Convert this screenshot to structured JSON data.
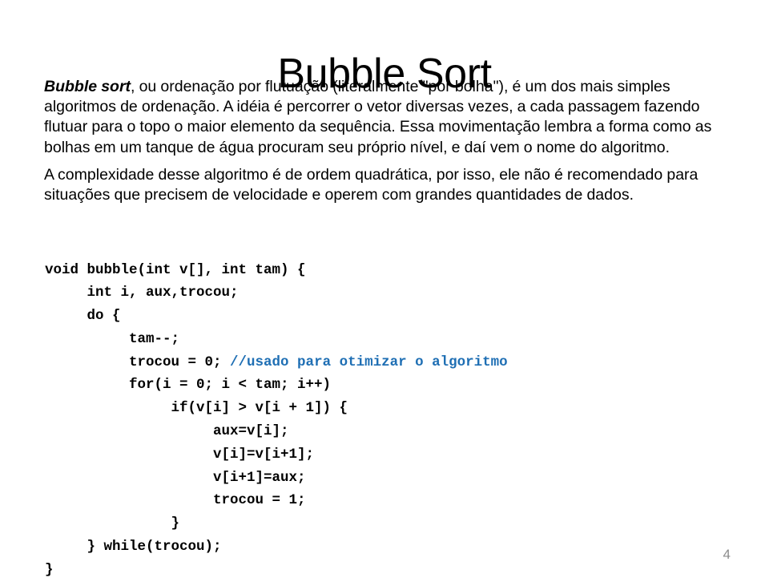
{
  "slide": {
    "title": "Bubble Sort",
    "page_number": "4",
    "background_color": "#FFFFFF",
    "text_color": "#000000",
    "comment_color": "#1F6FB4",
    "page_number_color": "#8C8C8C"
  },
  "body": {
    "paragraph1": {
      "emphasis": "Bubble sort",
      "rest": ", ou ordenação por flutuação (literalmente \"por bolha\"), é um dos mais simples algoritmos de ordenação. A idéia é percorrer o vetor diversas vezes, a cada passagem fazendo flutuar para o topo o maior elemento da sequência. Essa movimentação lembra a forma como as bolhas em um tanque de água procuram seu próprio nível, e daí vem o nome do algoritmo."
    },
    "paragraph2": "A complexidade desse algoritmo é de ordem quadrática, por isso, ele não é recomendado para situações que precisem de velocidade e operem com  grandes quantidades de dados."
  },
  "code": {
    "language": "c",
    "lines": [
      {
        "text": "void bubble(int v[], int tam) {",
        "comment": ""
      },
      {
        "text": "     int i, aux,trocou;",
        "comment": ""
      },
      {
        "text": "     do {",
        "comment": ""
      },
      {
        "text": "          tam--;",
        "comment": ""
      },
      {
        "text": "          trocou = 0; ",
        "comment": "//usado para otimizar o algoritmo"
      },
      {
        "text": "          for(i = 0; i < tam; i++)",
        "comment": ""
      },
      {
        "text": "               if(v[i] > v[i + 1]) {",
        "comment": ""
      },
      {
        "text": "                    aux=v[i];",
        "comment": ""
      },
      {
        "text": "                    v[i]=v[i+1];",
        "comment": ""
      },
      {
        "text": "                    v[i+1]=aux;",
        "comment": ""
      },
      {
        "text": "                    trocou = 1;",
        "comment": ""
      },
      {
        "text": "               }",
        "comment": ""
      },
      {
        "text": "     } while(trocou);",
        "comment": ""
      },
      {
        "text": "}",
        "comment": ""
      }
    ]
  }
}
